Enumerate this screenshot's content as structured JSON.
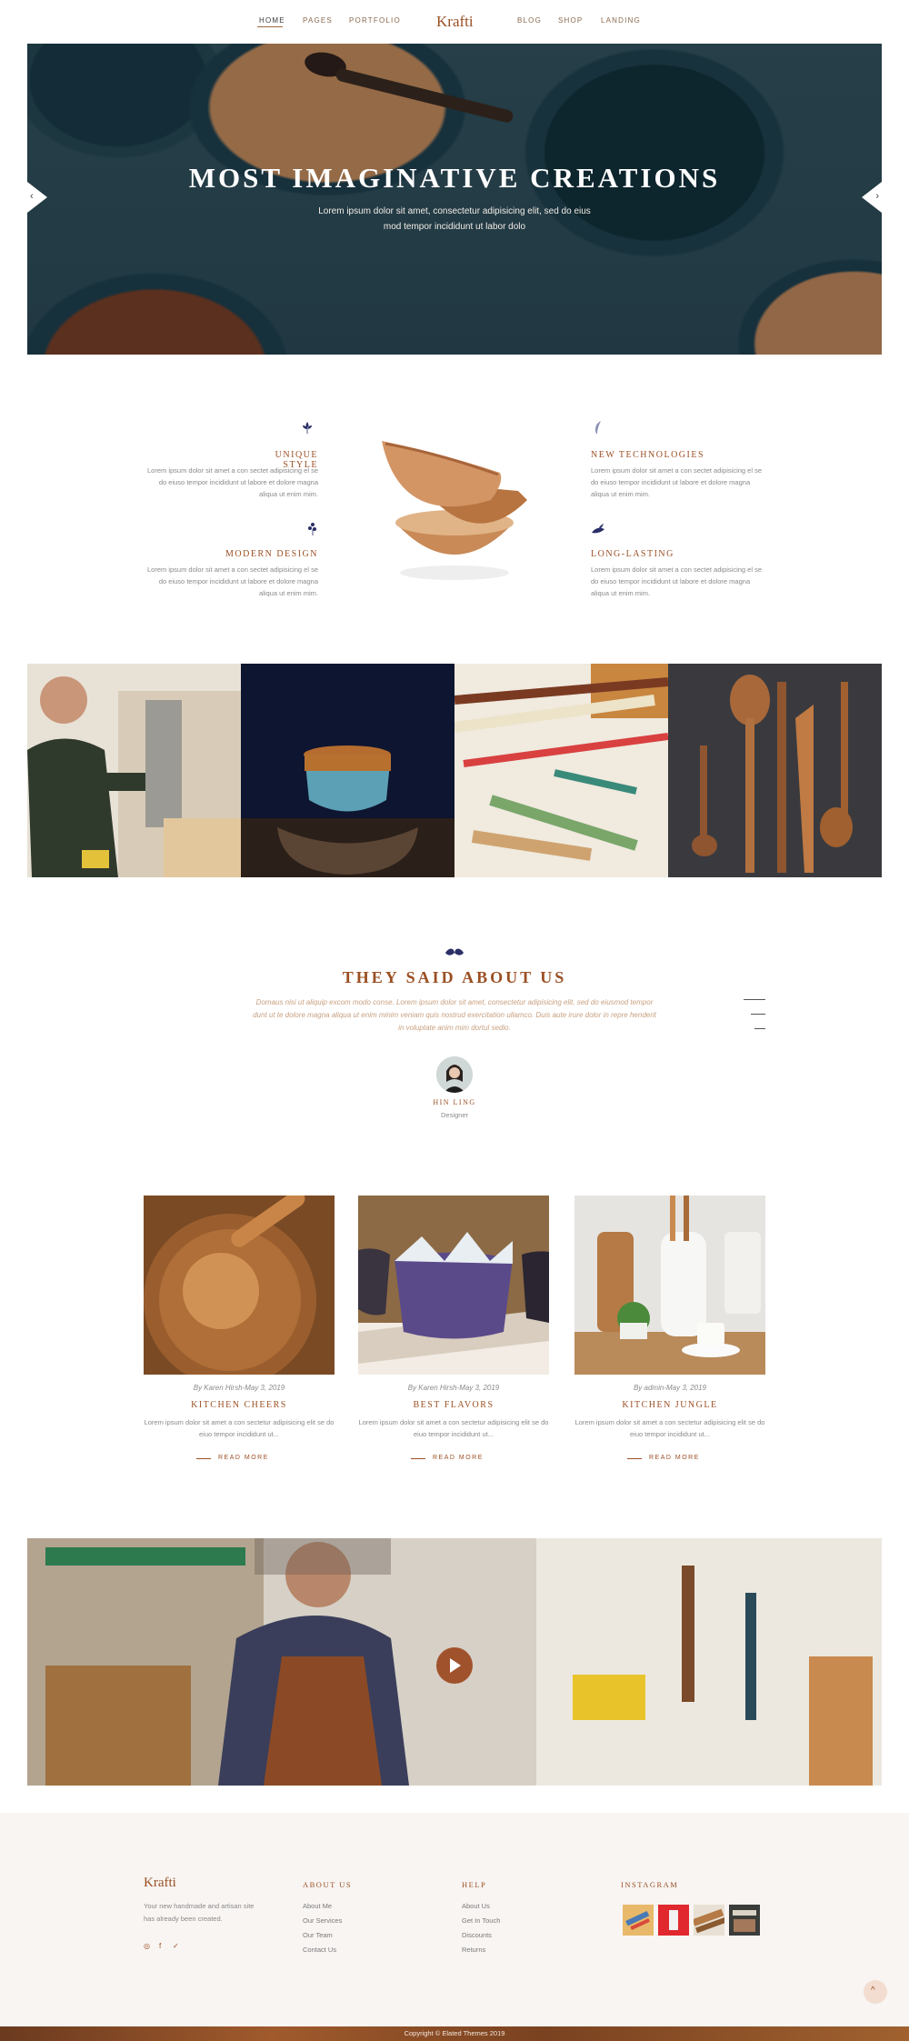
{
  "nav": {
    "left": [
      "HOME",
      "PAGES",
      "PORTFOLIO"
    ],
    "logo": "Krafti",
    "right": [
      "BLOG",
      "SHOP",
      "LANDING"
    ]
  },
  "hero": {
    "title": "MOST IMAGINATIVE CREATIONS",
    "subtitle_line1": "Lorem ipsum dolor sit amet, consectetur adipisicing elit, sed do eius",
    "subtitle_line2": "mod tempor incididunt ut labor dolo",
    "prev_icon": "chevron-left-icon",
    "next_icon": "chevron-right-icon"
  },
  "features": {
    "items": [
      {
        "title": "UNIQUE STYLE",
        "icon": "flower-icon",
        "text": "Lorem ipsum dolor sit amet a con sectet adipisicing el se do eiuso tempor incididunt ut labore et dolore magna aliqua ut enim mim."
      },
      {
        "title": "MODERN DESIGN",
        "icon": "flower-icon",
        "text": "Lorem ipsum dolor sit amet a con sectet adipisicing el se do eiuso tempor incididunt ut labore et dolore magna aliqua ut enim mim."
      },
      {
        "title": "NEW TECHNOLOGIES",
        "icon": "feather-icon",
        "text": "Lorem ipsum dolor sit amet a con sectet adipisicing el se do eiuso tempor incididunt ut labore et dolore magna aliqua ut enim mim."
      },
      {
        "title": "LONG-LASTING",
        "icon": "leaves-icon",
        "text": "Lorem ipsum dolor sit amet a con sectet adipisicing el se do eiuso tempor incididunt ut labore et dolore magna aliqua ut enim mim."
      }
    ]
  },
  "testimonial": {
    "title": "THEY SAID ABOUT US",
    "quote": "Domaus nisi ut aliquip excom modo conse. Lorem ipsum dolor sit amet, consectetur adipisicing elit, sed do eiusmod tempor dunt ut te dolore magna aliqua ut enim minim veniam quis nostrud exercitation ullamco. Duis aute irure dolor in repre henderit in voluptate anim mim dortul sedio.",
    "name": "HIN LING",
    "role": "Designer"
  },
  "posts": [
    {
      "meta": "By Karen Hirsh-May 3, 2019",
      "title": "KITCHEN CHEERS",
      "excerpt": "Lorem ipsum dolor sit amet a con sectetur adipisicing elit se do eiuo tempor incididunt ut...",
      "more": "READ MORE"
    },
    {
      "meta": "By Karen Hirsh-May 3, 2019",
      "title": "BEST FLAVORS",
      "excerpt": "Lorem ipsum dolor sit amet a con sectetur adipisicing elit se do eiuo tempor incididunt ut...",
      "more": "READ MORE"
    },
    {
      "meta": "By admin-May 3, 2019",
      "title": "KITCHEN JUNGLE",
      "excerpt": "Lorem ipsum dolor sit amet a con sectetur adipisicing elit se do eiuo tempor incididunt ut...",
      "more": "READ MORE"
    }
  ],
  "footer": {
    "logo": "Krafti",
    "desc": "Your new handmade and artisan site has already been created.",
    "social": [
      "instagram-icon",
      "facebook-icon",
      "twitter-icon"
    ],
    "about": {
      "title": "ABOUT US",
      "links": [
        "About Me",
        "Our Services",
        "Our Team",
        "Contact Us"
      ]
    },
    "help": {
      "title": "HELP",
      "links": [
        "About Us",
        "Get In Touch",
        "Discounts",
        "Returns"
      ]
    },
    "instagram": {
      "title": "INSTAGRAM"
    },
    "copyright": "Copyright © Elated Themes 2019"
  },
  "colors": {
    "accent": "#9b4f23",
    "hero_bg": "#2a4550",
    "footer_bg": "#f8f5f3"
  }
}
